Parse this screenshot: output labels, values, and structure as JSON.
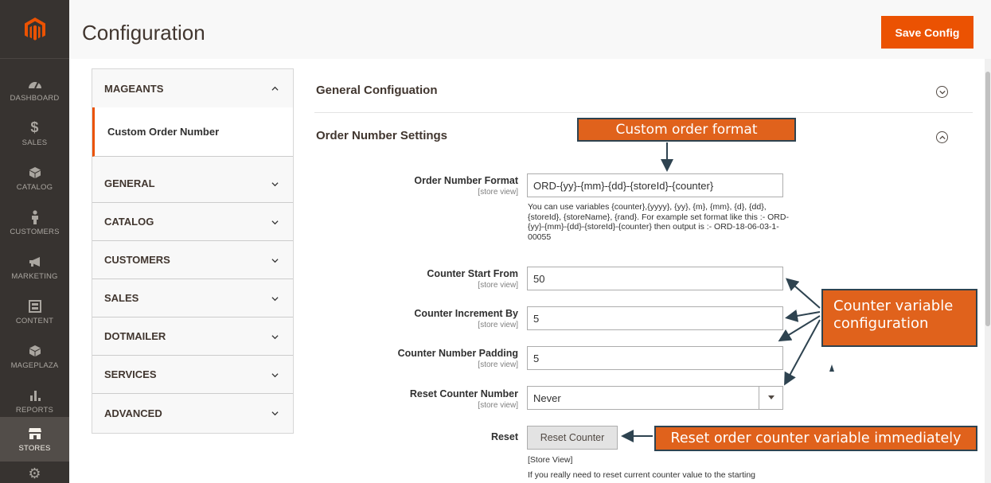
{
  "header": {
    "title": "Configuration",
    "save_label": "Save Config"
  },
  "nav": {
    "items": [
      {
        "label": "DASHBOARD",
        "icon": "dashboard-icon"
      },
      {
        "label": "SALES",
        "icon": "dollar-icon"
      },
      {
        "label": "CATALOG",
        "icon": "box-icon"
      },
      {
        "label": "CUSTOMERS",
        "icon": "person-icon"
      },
      {
        "label": "MARKETING",
        "icon": "megaphone-icon"
      },
      {
        "label": "CONTENT",
        "icon": "layout-icon"
      },
      {
        "label": "MAGEPLAZA",
        "icon": "box-icon"
      },
      {
        "label": "REPORTS",
        "icon": "bar-chart-icon"
      },
      {
        "label": "STORES",
        "icon": "storefront-icon"
      }
    ]
  },
  "tabs": {
    "mageants": "MAGEANTS",
    "custom_order_number": "Custom Order Number",
    "items": [
      "GENERAL",
      "CATALOG",
      "CUSTOMERS",
      "SALES",
      "DOTMAILER",
      "SERVICES",
      "ADVANCED"
    ]
  },
  "sections": {
    "general": "General Configuation",
    "order": "Order Number Settings"
  },
  "fields": {
    "scope": "[store view]",
    "format": {
      "label": "Order Number Format",
      "value": "ORD-{yy}-{mm}-{dd}-{storeId}-{counter}",
      "note": "You can use variables {counter},{yyyy}, {yy}, {m}, {mm}, {d}, {dd}, {storeId}, {storeName}, {rand}. For example set format like this :- ORD-{yy}-{mm}-{dd}-{storeId}-{counter} then output is :- ORD-18-06-03-1-00055"
    },
    "start": {
      "label": "Counter Start From",
      "value": "50"
    },
    "increment": {
      "label": "Counter Increment By",
      "value": "5"
    },
    "padding": {
      "label": "Counter Number Padding",
      "value": "5"
    },
    "reset_counter": {
      "label": "Reset Counter Number",
      "value": "Never"
    },
    "reset": {
      "label": "Reset",
      "button": "Reset Counter",
      "scope_note": "[Store View]",
      "note": "If you really need to reset current counter value to the starting"
    }
  },
  "annotations": {
    "format": "Custom order format",
    "counter_line1": "Counter variable",
    "counter_line2": "configuration",
    "reset": "Reset order counter variable immediately"
  },
  "colors": {
    "accent": "#eb5202",
    "nav_bg": "#373330",
    "callout": "#e0621c",
    "callout_border": "#2e4350"
  }
}
